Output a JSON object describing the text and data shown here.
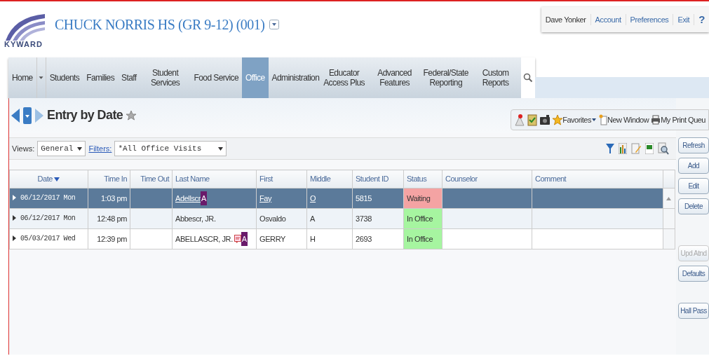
{
  "header": {
    "logo_text": "KYWARD",
    "school_title": "CHUCK NORRIS HS (GR 9-12) (001)"
  },
  "user_bar": [
    {
      "label": "Dave Yonker",
      "kind": "text"
    },
    {
      "label": "Account",
      "kind": "link"
    },
    {
      "label": "Preferences",
      "kind": "link"
    },
    {
      "label": "Exit",
      "kind": "link"
    },
    {
      "label": "?",
      "kind": "help"
    }
  ],
  "nav": [
    {
      "label": "Home",
      "selected": false,
      "kind": "home"
    },
    {
      "label": "Students",
      "selected": false
    },
    {
      "label": "Families",
      "selected": false
    },
    {
      "label": "Staff",
      "selected": false
    },
    {
      "label": "Student Services",
      "selected": false
    },
    {
      "label": "Food Service",
      "selected": false
    },
    {
      "label": "Office",
      "selected": true
    },
    {
      "label": "Administration",
      "selected": false
    },
    {
      "label": "Educator Access Plus",
      "selected": false
    },
    {
      "label": "Advanced Features",
      "selected": false
    },
    {
      "label": "Federal/State Reporting",
      "selected": false
    },
    {
      "label": "Custom Reports",
      "selected": false
    }
  ],
  "page_title": "Entry by Date",
  "toolbar": {
    "favorites": "Favorites",
    "new_window": "New Window",
    "print_queue": "My Print Queu"
  },
  "filters": {
    "views_label": "Views:",
    "views_value": "General",
    "filters_label": "Filters:",
    "filters_value": "*All Office Visits"
  },
  "table": {
    "columns": [
      {
        "label": "Date",
        "sorted": true
      },
      {
        "label": "Time In"
      },
      {
        "label": "Time Out"
      },
      {
        "label": "Last Name"
      },
      {
        "label": "First"
      },
      {
        "label": "Middle"
      },
      {
        "label": "Student ID"
      },
      {
        "label": "Status"
      },
      {
        "label": "Counselor"
      },
      {
        "label": "Comment"
      }
    ],
    "rows": [
      {
        "selected": true,
        "date": "06/12/2017 Mon",
        "time_in": "1:03 pm",
        "last_name": "Adellscr",
        "note": false,
        "badge": "A",
        "first": "Fay",
        "middle": "O",
        "student_id": "5815",
        "status": {
          "text": "Waiting",
          "color": "#f4a3a3"
        }
      },
      {
        "selected": false,
        "date": "06/12/2017 Mon",
        "time_in": "12:48 pm",
        "last_name": "Abbescr, JR.",
        "note": false,
        "first": "Osvaldo",
        "middle": "A",
        "student_id": "3738",
        "status": {
          "text": "In Office",
          "color": "#a6f5a0"
        }
      },
      {
        "selected": false,
        "date": "05/03/2017 Wed",
        "time_in": "12:39 pm",
        "last_name": "ABELLASCR, JR.",
        "note": true,
        "badge": "A",
        "first": "GERRY",
        "middle": "H",
        "student_id": "2693",
        "status": {
          "text": "In Office",
          "color": "#a6f5a0"
        }
      }
    ]
  },
  "side_buttons": [
    {
      "label": "Refresh",
      "disabled": false
    },
    {
      "label": "Add",
      "disabled": false
    },
    {
      "label": "Edit",
      "disabled": false
    },
    {
      "label": "Delete",
      "disabled": false
    },
    {
      "label": "Upd Atnd",
      "disabled": true
    },
    {
      "label": "Defaults",
      "disabled": false
    },
    {
      "label": "Hall Pass",
      "disabled": false
    }
  ]
}
